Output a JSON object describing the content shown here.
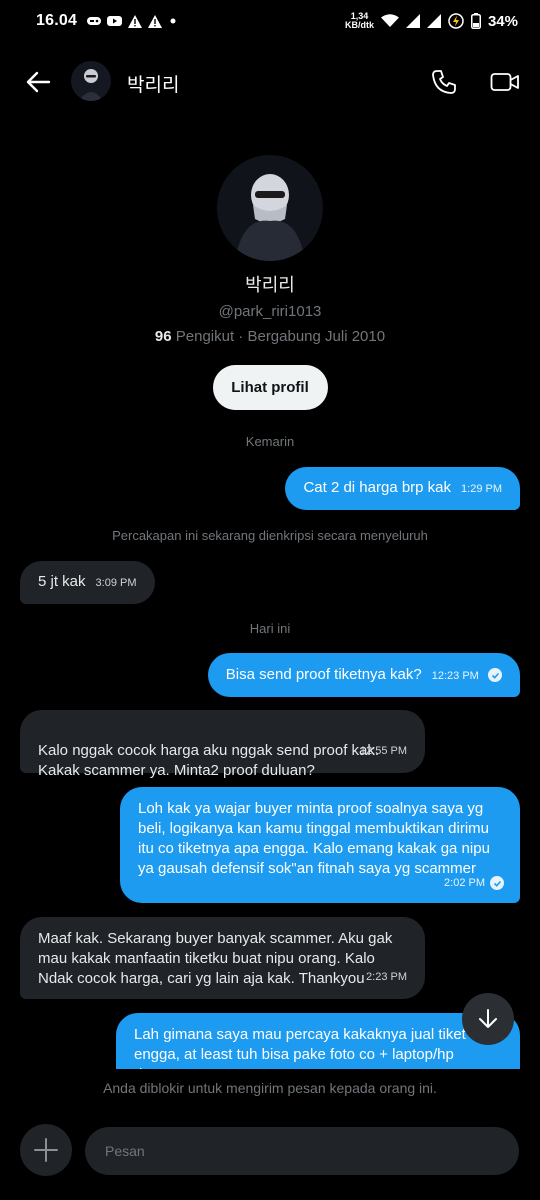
{
  "status": {
    "time": "16.04",
    "net_speed_value": "1,34",
    "net_speed_unit": "KB/dtk",
    "battery": "34%"
  },
  "header": {
    "name": "박리리"
  },
  "profile": {
    "name": "박리리",
    "handle": "@park_riri1013",
    "followers_count": "96",
    "followers_label": "Pengikut · Bergabung Juli 2010",
    "button_label": "Lihat profil"
  },
  "separators": {
    "yesterday": "Kemarin",
    "encryption": "Percakapan ini sekarang dienkripsi secara menyeluruh",
    "today": "Hari ini"
  },
  "messages": [
    {
      "dir": "out",
      "text": "Cat 2 di harga brp kak",
      "time": "1:29 PM"
    },
    {
      "dir": "in",
      "text": "5 jt kak",
      "time": "3:09 PM"
    },
    {
      "dir": "out",
      "text": "Bisa send proof tiketnya kak?",
      "time": "12:23 PM"
    },
    {
      "dir": "in",
      "text": "Kalo nggak cocok harga aku nggak send proof kak.\nKakak scammer ya. Minta2 proof duluan?",
      "time": "12:55 PM"
    },
    {
      "dir": "out",
      "text": "Loh kak ya wajar buyer minta proof soalnya saya yg beli, logikanya kan kamu tinggal membuktikan dirimu itu co tiketnya apa engga. Kalo emang kakak ga nipu ya gausah defensif sok\"an fitnah saya yg scammer",
      "time": "2:02 PM"
    },
    {
      "dir": "in",
      "text": "Maaf kak. Sekarang buyer banyak scammer. Aku gak mau kakak manfaatin tiketku buat nipu orang. Kalo Ndak cocok harga, cari yg lain aja kak. Thankyou",
      "time": "2:23 PM"
    },
    {
      "dir": "out",
      "text": "Lah gimana saya mau percaya kakaknya jual tiket apa engga, at least tuh bisa pake foto co + laptop/hp dengan",
      "time": ""
    }
  ],
  "blocked_notice": "Anda diblokir untuk mengirim pesan kepada orang ini.",
  "composer": {
    "placeholder": "Pesan"
  },
  "colors": {
    "accent": "#1d9bf0",
    "incoming_bubble": "#202327",
    "background": "#000000"
  }
}
